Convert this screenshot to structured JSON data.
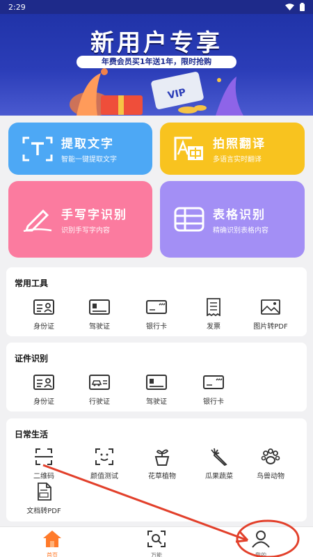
{
  "status_bar": {
    "time": "2:29"
  },
  "banner": {
    "title": "新用户专享",
    "subtitle": "年费会员买1年送1年，限时抢购",
    "card_text": "VIP"
  },
  "feature_cards": [
    {
      "title": "提取文字",
      "subtitle": "智能一键提取文字",
      "color": "#4da8f5",
      "icon": "text-extract-icon"
    },
    {
      "title": "拍照翻译",
      "subtitle": "多语言实时翻译",
      "color": "#f8c31f",
      "icon": "translate-icon"
    },
    {
      "title": "手写字识别",
      "subtitle": "识别手写字内容",
      "color": "#fb7b9f",
      "icon": "handwriting-pen-icon"
    },
    {
      "title": "表格识别",
      "subtitle": "精确识别表格内容",
      "color": "#a38ff5",
      "icon": "table-grid-icon"
    }
  ],
  "sections": {
    "common_tools": {
      "title": "常用工具",
      "items": [
        {
          "label": "身份证",
          "icon": "id-card-icon"
        },
        {
          "label": "驾驶证",
          "icon": "driver-license-icon"
        },
        {
          "label": "银行卡",
          "icon": "bank-card-icon"
        },
        {
          "label": "发票",
          "icon": "invoice-icon"
        },
        {
          "label": "图片转PDF",
          "icon": "image-to-pdf-icon"
        }
      ]
    },
    "certificate": {
      "title": "证件识别",
      "items": [
        {
          "label": "身份证",
          "icon": "id-card-icon"
        },
        {
          "label": "行驶证",
          "icon": "vehicle-license-icon"
        },
        {
          "label": "驾驶证",
          "icon": "driver-license-icon"
        },
        {
          "label": "银行卡",
          "icon": "bank-card-icon"
        }
      ]
    },
    "daily_life": {
      "title": "日常生活",
      "items": [
        {
          "label": "二维码",
          "icon": "qr-scan-icon"
        },
        {
          "label": "颜值测试",
          "icon": "face-scan-icon"
        },
        {
          "label": "花草植物",
          "icon": "plant-pot-icon"
        },
        {
          "label": "瓜果蔬菜",
          "icon": "carrot-icon"
        },
        {
          "label": "鸟兽动物",
          "icon": "paw-icon"
        },
        {
          "label": "文档转PDF",
          "icon": "document-pdf-icon"
        }
      ]
    }
  },
  "bottom_nav": [
    {
      "label": "首页",
      "icon": "home-icon",
      "active": true
    },
    {
      "label": "万能",
      "icon": "scan-search-icon",
      "active": false
    },
    {
      "label": "我的",
      "icon": "user-profile-icon",
      "active": false
    }
  ],
  "colors": {
    "accent": "#ff7a2a",
    "annotation": "#e2402b"
  }
}
